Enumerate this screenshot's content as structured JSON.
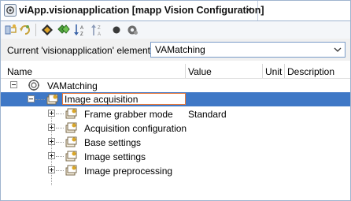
{
  "tab": {
    "title": "viApp.visionapplication [mapp Vision Configuration]",
    "close_glyph": "×",
    "icon": "vision-app-icon"
  },
  "toolbar": {
    "buttons": [
      "configure-icon",
      "refresh-icon",
      "diamond-icon",
      "green-gem-icon",
      "sort-ascending-icon",
      "sort-descending-icon",
      "record-icon",
      "gear-circle-icon"
    ]
  },
  "selector": {
    "label": "Current 'visionapplication' element:",
    "value": "VAMatching"
  },
  "grid": {
    "columns": {
      "name": "Name",
      "value": "Value",
      "unit": "Unit",
      "description": "Description"
    },
    "root": {
      "label": "VAMatching",
      "expanded": true
    },
    "selected_node": {
      "label": "Image acquisition",
      "expanded": true
    },
    "children": [
      {
        "label": "Frame grabber mode",
        "value": "Standard"
      },
      {
        "label": "Acquisition configuration",
        "value": ""
      },
      {
        "label": "Base settings",
        "value": ""
      },
      {
        "label": "Image settings",
        "value": ""
      },
      {
        "label": "Image preprocessing",
        "value": ""
      }
    ]
  },
  "colors": {
    "selection": "#3f78c6",
    "edit_border": "#e8793a",
    "window_border": "#9fb4cf"
  }
}
